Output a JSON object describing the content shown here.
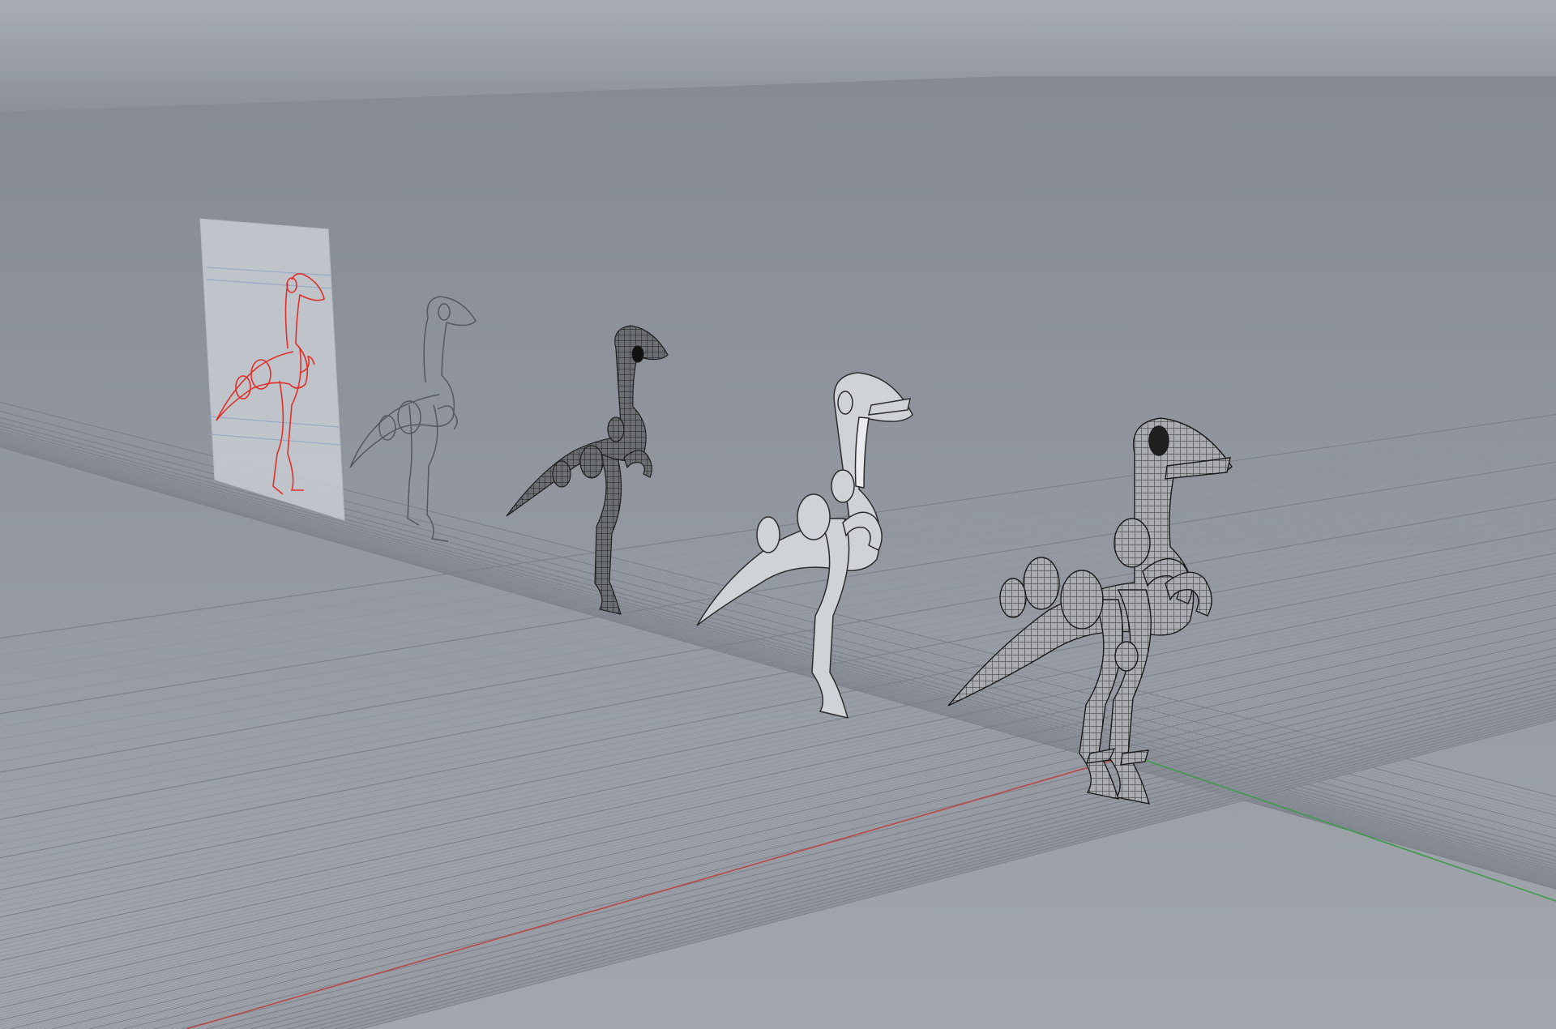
{
  "viewport": {
    "kind": "3d-perspective-viewport",
    "visible_text": [],
    "colors": {
      "sky_top": "#a7acb3",
      "sky_bottom": "#8a8f98",
      "ground": "#9ea3ab",
      "grid_minor": "#8c919a",
      "grid_major": "#7b8089",
      "x_axis": "#c04a4a",
      "y_axis": "#3e9a4a",
      "reference_curve": "#e0302a",
      "wireframe": "#2a2a2a",
      "shaded": "#cfd2d6",
      "dark_mesh": "#3a3a3a"
    },
    "objects": [
      {
        "name": "reference-image-plane",
        "style": "red curves on translucent card"
      },
      {
        "name": "dinosaur-curves-outline",
        "style": "grey curve outline"
      },
      {
        "name": "dinosaur-dark-mesh",
        "style": "dense dark polygon mesh"
      },
      {
        "name": "dinosaur-shaded-surface",
        "style": "light shaded surfaces"
      },
      {
        "name": "dinosaur-mesh-final",
        "style": "wireframe mesh, largest, at origin"
      }
    ]
  }
}
